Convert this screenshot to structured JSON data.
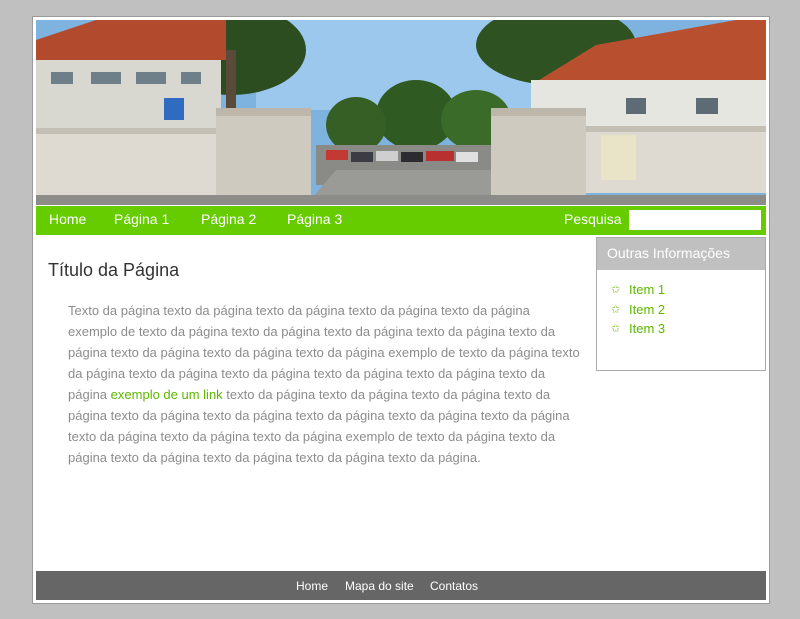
{
  "nav": {
    "items": [
      {
        "label": "Home"
      },
      {
        "label": "Página 1"
      },
      {
        "label": "Página 2"
      },
      {
        "label": "Página 3"
      }
    ],
    "search_label": "Pesquisa",
    "search_value": ""
  },
  "main": {
    "title": "Título da Página",
    "text_before_link": "Texto da página texto da página texto da página texto da página texto da página exemplo de texto da página texto da página texto da página texto da página texto da página texto da página texto da página texto da página exemplo de texto da página texto da página texto da página texto da página texto da página texto da página texto da página",
    "link_text": "exemplo de um link",
    "text_after_link": "texto da página texto da página texto da página texto da página texto da página texto da página texto da página texto da página texto da página texto da página texto da página texto da página exemplo de texto da página texto da página texto da página texto da página texto da página texto da página."
  },
  "sidebar": {
    "heading": "Outras Informações",
    "items": [
      {
        "label": "Item 1"
      },
      {
        "label": "Item 2"
      },
      {
        "label": "Item 3"
      }
    ]
  },
  "footer": {
    "links": [
      {
        "label": "Home"
      },
      {
        "label": "Mapa do site"
      },
      {
        "label": "Contatos"
      }
    ]
  },
  "colors": {
    "background": "#c0c0c0",
    "nav_green": "#66cc00",
    "link_green": "#5cb800",
    "footer_gray": "#666666",
    "body_text_gray": "#8c8c8c"
  }
}
